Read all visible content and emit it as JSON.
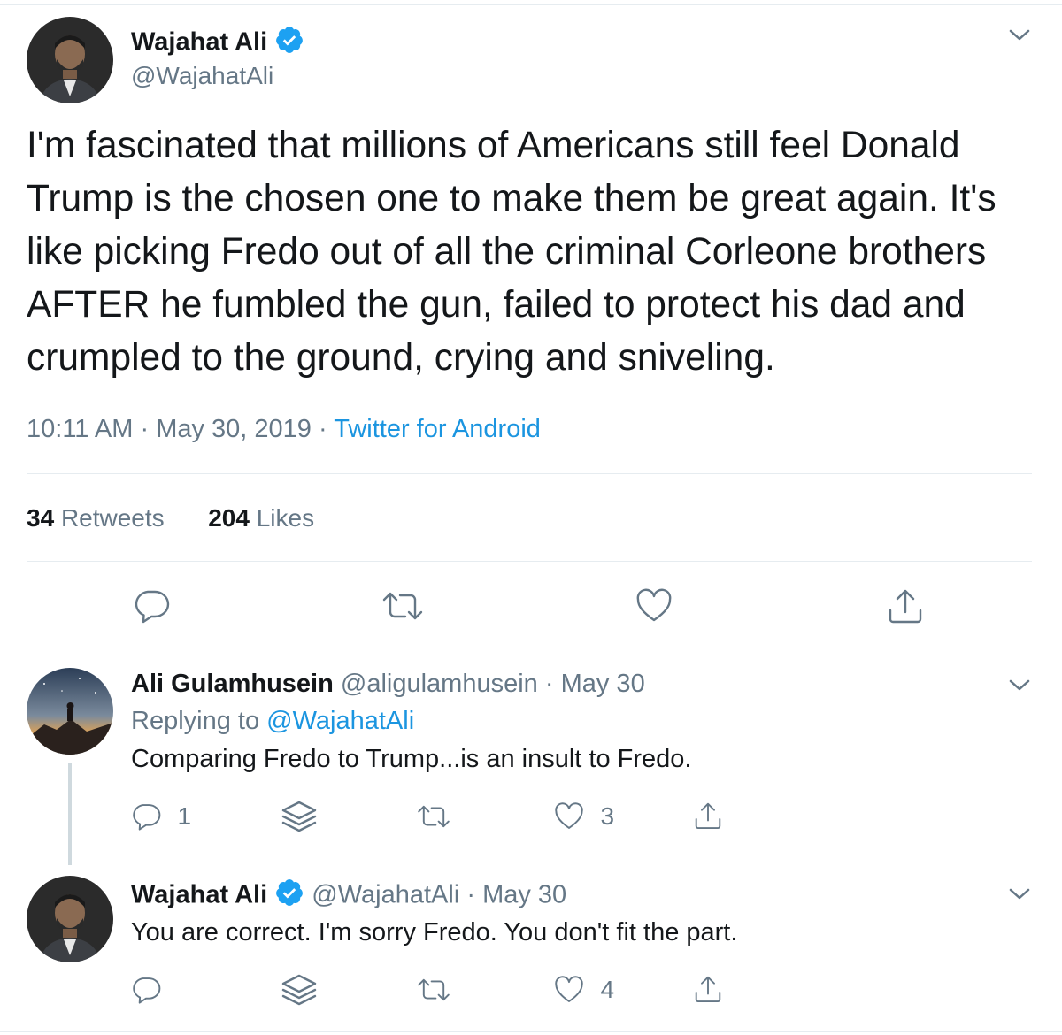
{
  "main_tweet": {
    "author_name": "Wajahat Ali",
    "author_handle": "@WajahatAli",
    "text": "I'm fascinated that millions of Americans still feel Donald Trump is the chosen one to make them be great again. It's like picking Fredo out of all the criminal Corleone brothers AFTER he fumbled the gun, failed to protect his dad and crumpled to the ground, crying and sniveling.",
    "time": "10:11 AM",
    "date": "May 30, 2019",
    "separator": "·",
    "source": "Twitter for Android",
    "retweets_count": "34",
    "retweets_label": "Retweets",
    "likes_count": "204",
    "likes_label": "Likes"
  },
  "reply1": {
    "author_name": "Ali Gulamhusein",
    "author_handle": "@aligulamhusein",
    "date": "May 30",
    "separator": "·",
    "replying_prefix": "Replying to",
    "replying_handle": "@WajahatAli",
    "text": "Comparing Fredo to Trump...is an insult to Fredo.",
    "reply_count": "1",
    "like_count": "3"
  },
  "reply2": {
    "author_name": "Wajahat Ali",
    "author_handle": "@WajahatAli",
    "date": "May 30",
    "separator": "·",
    "text": "You are correct. I'm sorry Fredo. You don't fit the part.",
    "like_count": "4"
  },
  "icons": {
    "reply": "comment-bubble-icon",
    "retweet": "retweet-icon",
    "like": "heart-icon",
    "share": "share-icon",
    "stack": "layers-icon",
    "menu": "chevron-down-icon",
    "verified": "verified-badge-icon"
  },
  "colors": {
    "link": "#1b95e0",
    "secondary_text": "#657786",
    "primary_text": "#14171a",
    "verified": "#1da1f2"
  }
}
